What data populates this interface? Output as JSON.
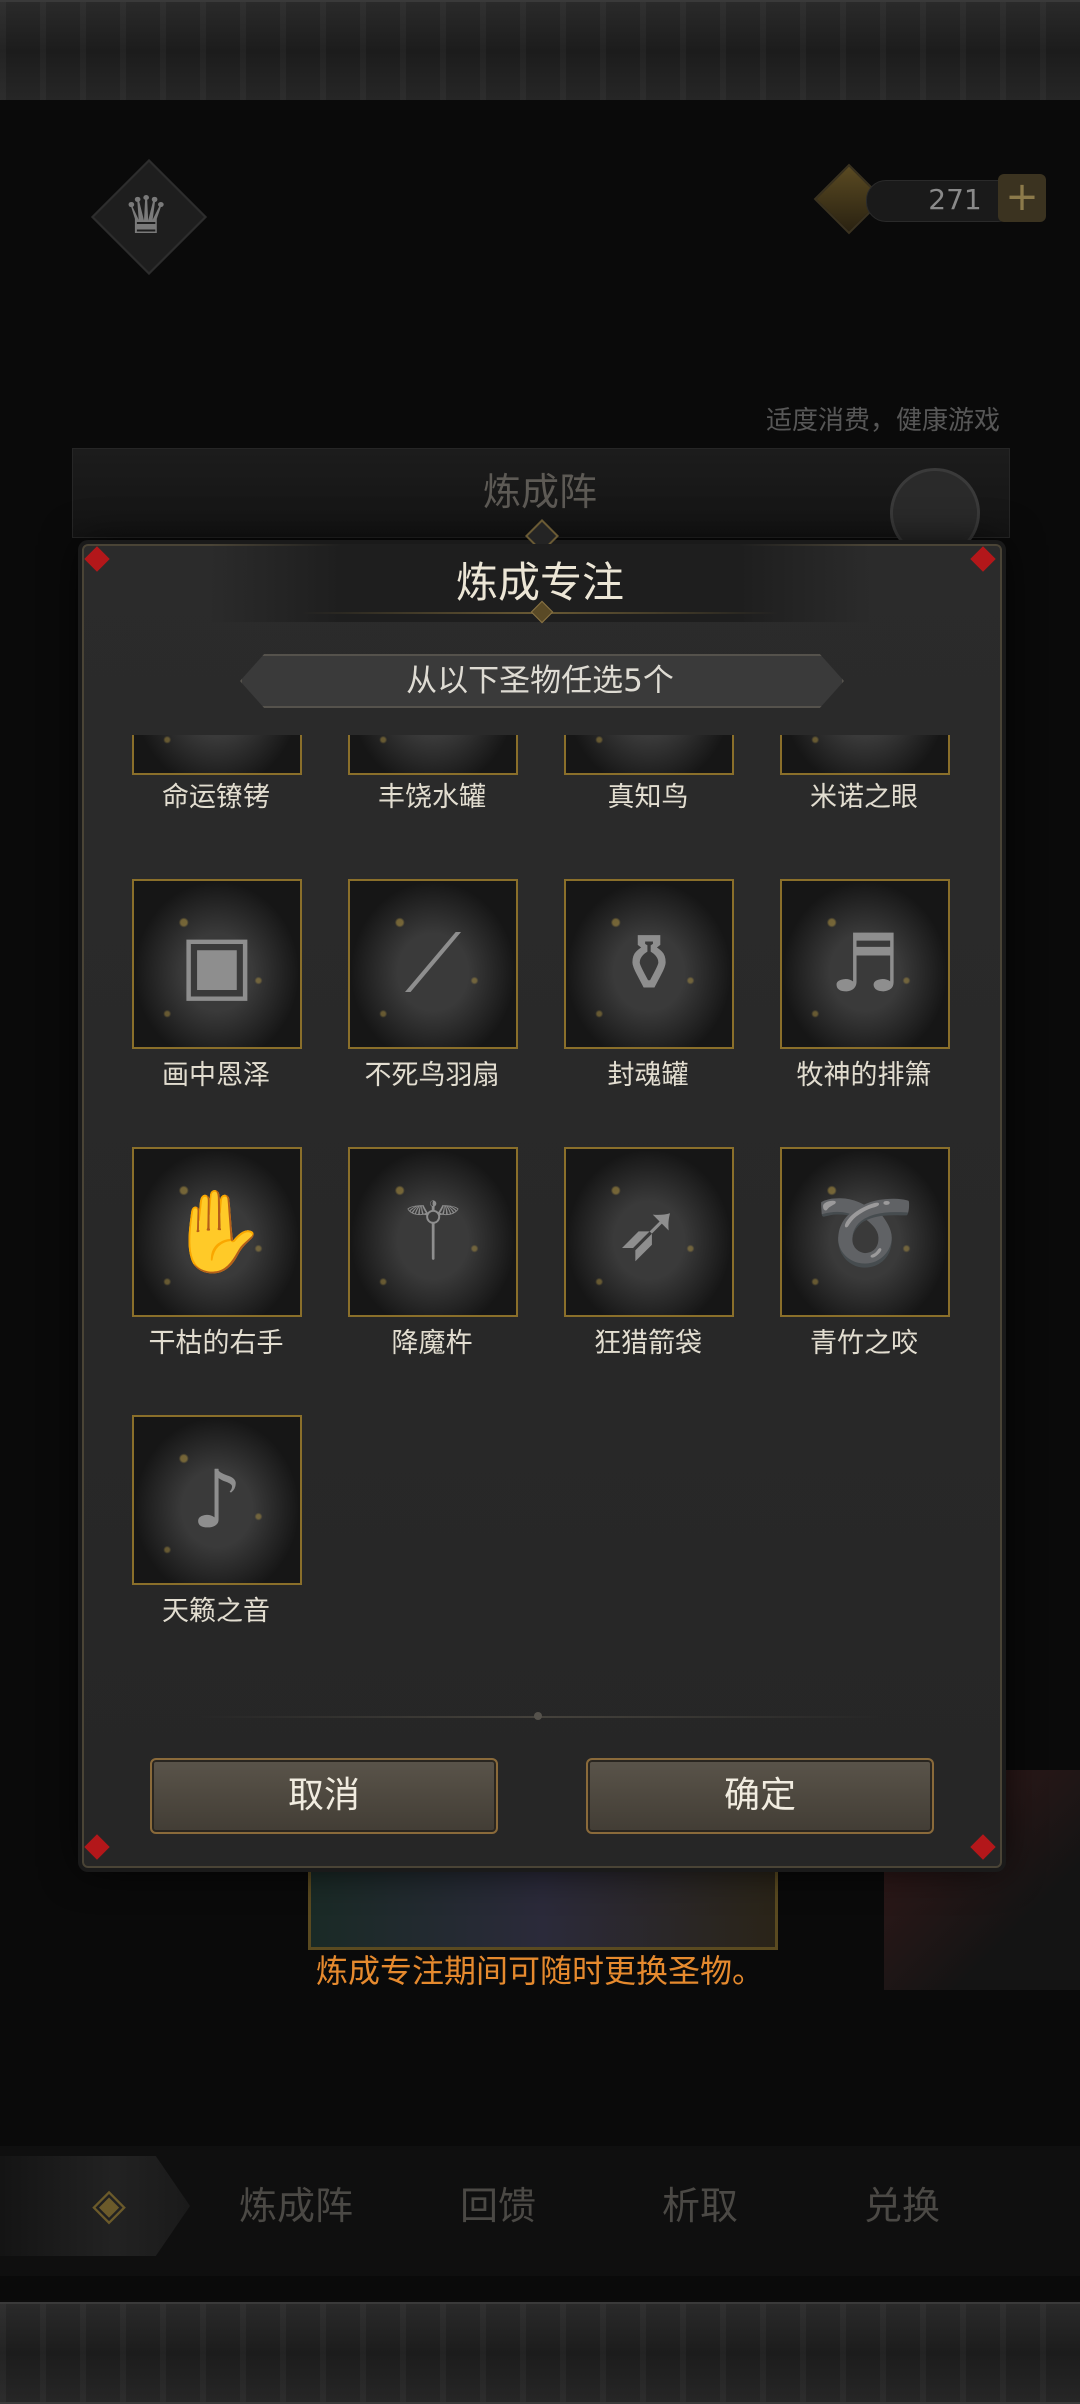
{
  "header": {
    "currency_amount": "271",
    "plus_glyph": "+"
  },
  "notice": "适度消费，健康游戏",
  "background_panel": {
    "title": "炼成阵"
  },
  "modal": {
    "title": "炼成专注",
    "subtitle": "从以下圣物任选5个",
    "items": [
      {
        "name": "命运镣铐",
        "icon": "shackle-icon"
      },
      {
        "name": "丰饶水罐",
        "icon": "water-jar-icon"
      },
      {
        "name": "真知鸟",
        "icon": "bird-icon"
      },
      {
        "name": "米诺之眼",
        "icon": "eye-icon"
      },
      {
        "name": "画中恩泽",
        "icon": "picture-frame-icon"
      },
      {
        "name": "不死鸟羽扇",
        "icon": "feather-fan-icon"
      },
      {
        "name": "封魂罐",
        "icon": "soul-urn-icon"
      },
      {
        "name": "牧神的排箫",
        "icon": "pan-flute-icon"
      },
      {
        "name": "干枯的右手",
        "icon": "withered-hand-icon"
      },
      {
        "name": "降魔杵",
        "icon": "vajra-icon"
      },
      {
        "name": "狂猎箭袋",
        "icon": "quiver-icon"
      },
      {
        "name": "青竹之咬",
        "icon": "whip-icon"
      },
      {
        "name": "天籁之音",
        "icon": "music-box-icon"
      }
    ],
    "cancel_label": "取消",
    "confirm_label": "确定"
  },
  "hint": "炼成专注期间可随时更换圣物。",
  "bottom_nav": {
    "items": [
      {
        "label": "炼成阵"
      },
      {
        "label": "回馈"
      },
      {
        "label": "析取"
      },
      {
        "label": "兑换"
      }
    ]
  },
  "colors": {
    "accent_gold": "#8a6f2a",
    "hint_orange": "#e68a2e",
    "corner_red": "#b3171a"
  }
}
